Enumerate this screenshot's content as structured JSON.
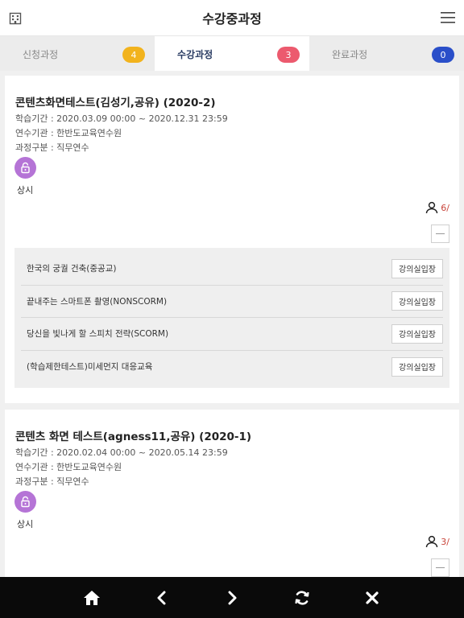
{
  "header": {
    "title": "수강중과정"
  },
  "tabs": [
    {
      "label": "신청과정",
      "count": "4",
      "color": "#f2b31d"
    },
    {
      "label": "수강과정",
      "count": "3",
      "color": "#ec5a6e"
    },
    {
      "label": "완료과정",
      "count": "0",
      "color": "#2a4fc9"
    }
  ],
  "courses": [
    {
      "title": "콘텐츠화면테스트(김성기,공유) (2020-2)",
      "period": "학습기간 : 2020.03.09 00:00 ~ 2020.12.31 23:59",
      "institute": "연수기관 : 한반도교육연수원",
      "category": "과정구분 : 직무연수",
      "badge_label": "상시",
      "learners": "6/",
      "lessons": [
        {
          "name": "한국의 궁궐 건축(중공교)",
          "button": "강의실입장"
        },
        {
          "name": "끝내주는 스마트폰 촬영(NONSCORM)",
          "button": "강의실입장"
        },
        {
          "name": "당신을 빛나게 할 스피치 전략(SCORM)",
          "button": "강의실입장"
        },
        {
          "name": "(학습제한테스트)미세먼지 대응교육",
          "button": "강의실입장"
        }
      ]
    },
    {
      "title": "콘텐츠 화면 테스트(agness11,공유) (2020-1)",
      "period": "학습기간 : 2020.02.04 00:00 ~ 2020.05.14 23:59",
      "institute": "연수기관 : 한반도교육연수원",
      "category": "과정구분 : 직무연수",
      "badge_label": "상시",
      "learners": "3/"
    }
  ],
  "icons": {
    "header_left": "building-icon",
    "header_right": "hamburger-menu-icon",
    "course_badge": "unlock-icon",
    "learners": "person-icon",
    "collapse": "minus-icon",
    "nav": [
      "home-icon",
      "back-icon",
      "forward-icon",
      "refresh-icon",
      "close-icon"
    ]
  },
  "colors": {
    "badge_purple": "#b574d6",
    "learner_count": "#c9443a",
    "active_tab_text": "#2a3c63"
  }
}
